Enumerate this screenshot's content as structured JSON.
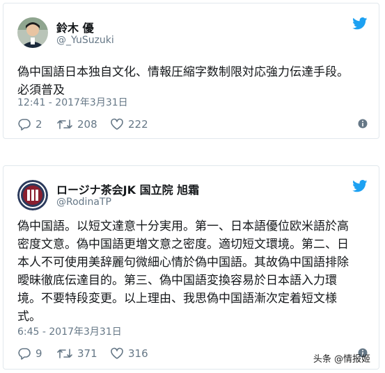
{
  "tweets": [
    {
      "display_name": "鈴木 優",
      "handle": "@_YuSuzuki",
      "text": "偽中国語日本独自文化、情報圧縮字数制限対応強力伝達手段。\n必須普及",
      "timestamp": "12:41 - 2017年3月31日",
      "replies": "2",
      "retweets": "208",
      "likes": "222"
    },
    {
      "display_name": "ロージナ茶会JK 国立院 旭霜",
      "handle": "@RodinaTP",
      "text": "偽中国語。以短文達意十分実用。第一、日本語優位欧米語於高\n密度文意。偽中国語更増文意之密度。適切短文環境。第二、日\n本人不可使用美辞麗句微細心情於偽中国語。其故偽中国語排除\n曖昧徹底伝達目的。第三、偽中国語変換容易於日本語入力環\n境。不要特段変更。以上理由、我思偽中国語漸次定着短文様\n式。",
      "timestamp": "6:45 - 2017年3月31日",
      "replies": "9",
      "retweets": "371",
      "likes": "316"
    }
  ],
  "watermark": "头条 @情报姬",
  "colors": {
    "text": "#14171a",
    "muted": "#657786",
    "twitter_blue": "#1da1f2",
    "border": "#e1e8ed"
  }
}
